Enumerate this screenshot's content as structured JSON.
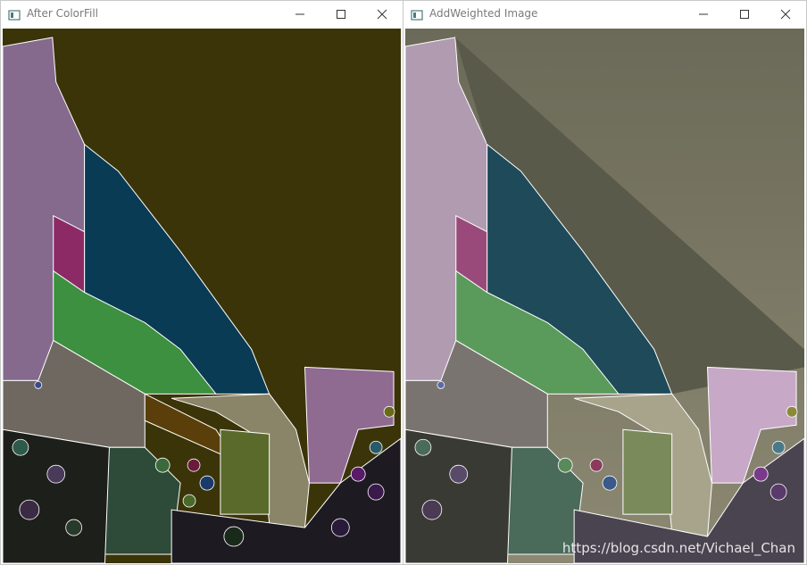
{
  "windows": {
    "left": {
      "title": "After ColorFill"
    },
    "right": {
      "title": "AddWeighted Image",
      "watermark": "https://blog.csdn.net/Vichael_Chan"
    }
  },
  "icons": {
    "app": "opencv-window-icon",
    "minimize": "minimize-icon",
    "maximize": "maximize-icon",
    "close": "close-icon"
  },
  "colors": {
    "sky_fill": "#3b3408",
    "sky_blend": "#6b6a55",
    "region_purple": "#856a8d",
    "region_navy": "#0a3b55",
    "region_magenta": "#8c2a66",
    "region_green": "#3c9040",
    "region_taupe": "#6f6860",
    "region_olive": "#5a6a2a",
    "region_brown": "#5a3f0a",
    "region_teal": "#2e4a38",
    "region_pale": "#8a8468",
    "region_pink": "#8f6a91",
    "ground": "#1d1f1a"
  }
}
